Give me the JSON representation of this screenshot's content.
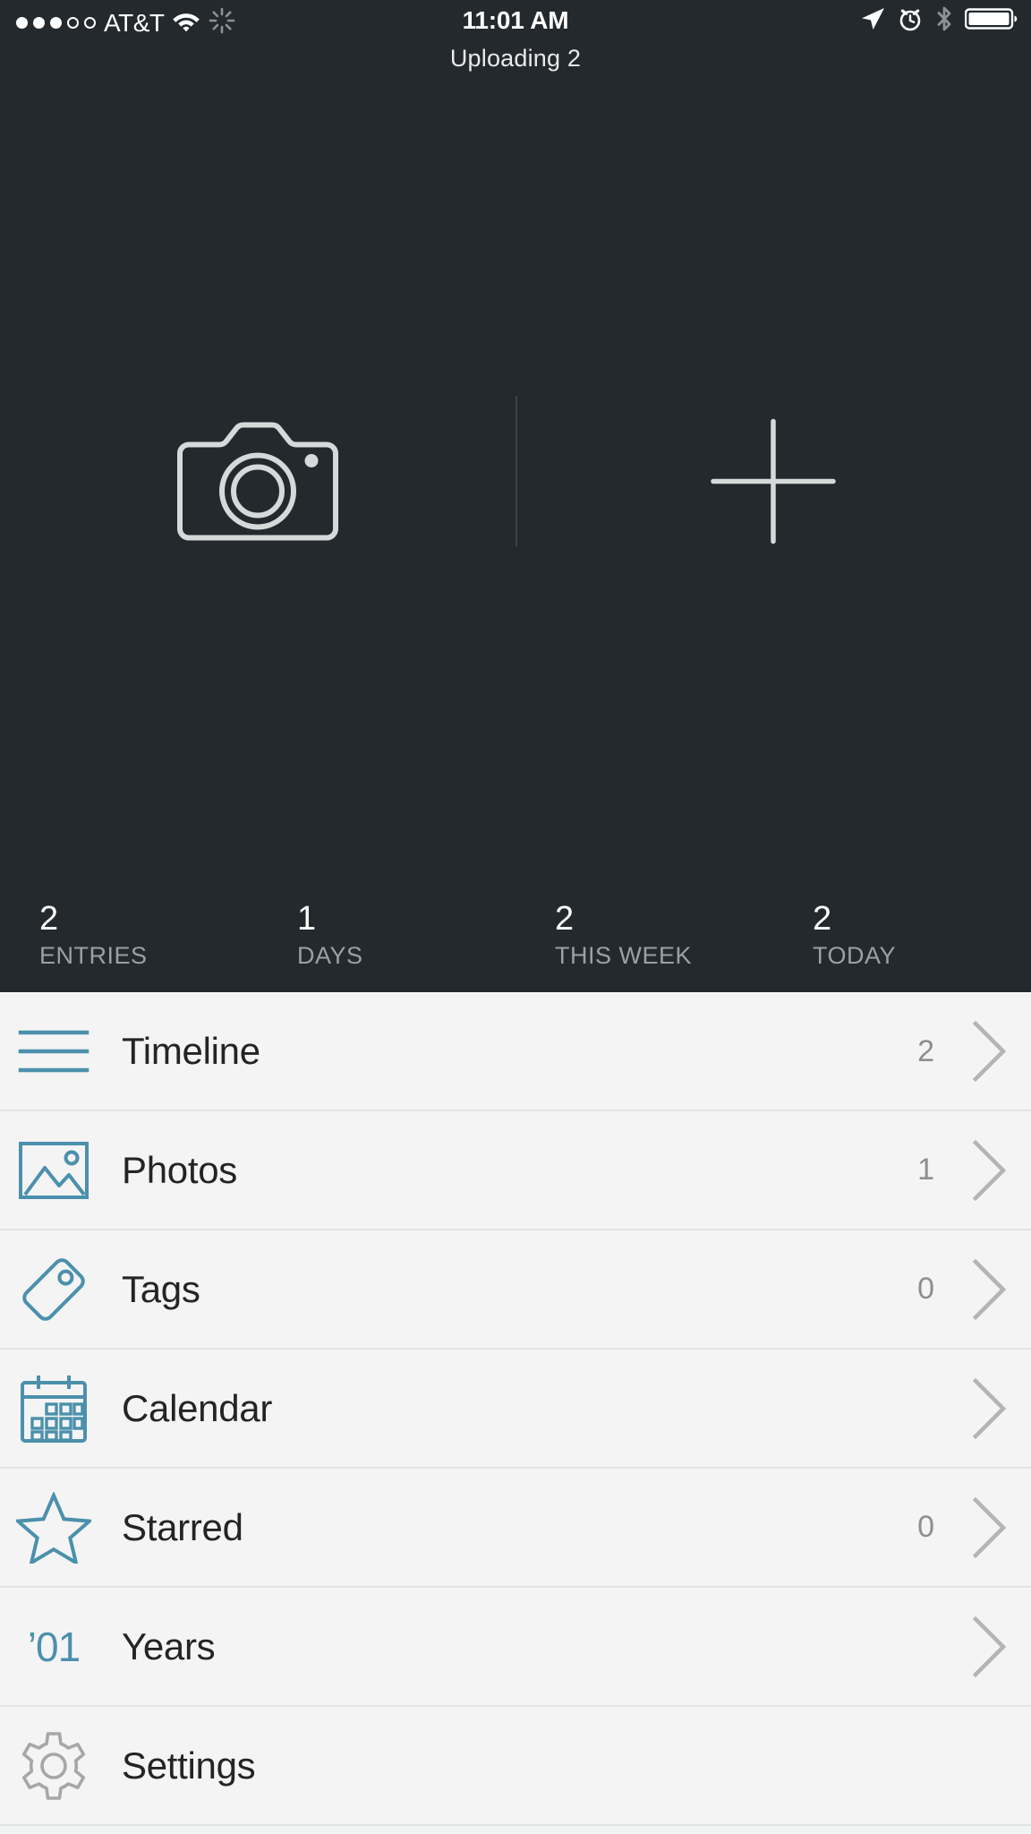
{
  "status_bar": {
    "signal_dots_total": 5,
    "signal_dots_filled": 3,
    "carrier": "AT&T",
    "wifi_icon": "wifi-icon",
    "activity_icon": "activity-spinner-icon",
    "time": "11:01 AM",
    "location_icon": "location-arrow-icon",
    "alarm_icon": "alarm-clock-icon",
    "bluetooth_icon": "bluetooth-icon",
    "battery_icon": "battery-full-icon"
  },
  "header": {
    "uploading_status": "Uploading 2"
  },
  "capture": {
    "camera_button": "camera-icon",
    "add_button": "plus-icon"
  },
  "stats": [
    {
      "value": "2",
      "label": "ENTRIES"
    },
    {
      "value": "1",
      "label": "DAYS"
    },
    {
      "value": "2",
      "label": "THIS WEEK"
    },
    {
      "value": "2",
      "label": "TODAY"
    }
  ],
  "menu": [
    {
      "label": "Timeline",
      "count": "2",
      "icon": "lines-icon",
      "chevron": true
    },
    {
      "label": "Photos",
      "count": "1",
      "icon": "photo-icon",
      "chevron": true
    },
    {
      "label": "Tags",
      "count": "0",
      "icon": "tag-icon",
      "chevron": true
    },
    {
      "label": "Calendar",
      "count": "",
      "icon": "calendar-icon",
      "chevron": true
    },
    {
      "label": "Starred",
      "count": "0",
      "icon": "star-icon",
      "chevron": true
    },
    {
      "label": "Years",
      "count": "",
      "icon": "years-icon",
      "glyph": "’01",
      "chevron": true
    },
    {
      "label": "Settings",
      "count": "",
      "icon": "gear-icon",
      "chevron": false
    }
  ],
  "colors": {
    "hero_background": "#24292d",
    "list_background": "#f4f4f4",
    "accent_teal": "#4b90ac",
    "icon_gray": "#9b9b9b",
    "text_dark": "#242424",
    "text_muted": "#8c8f90",
    "stat_label": "#9aa0a3"
  }
}
